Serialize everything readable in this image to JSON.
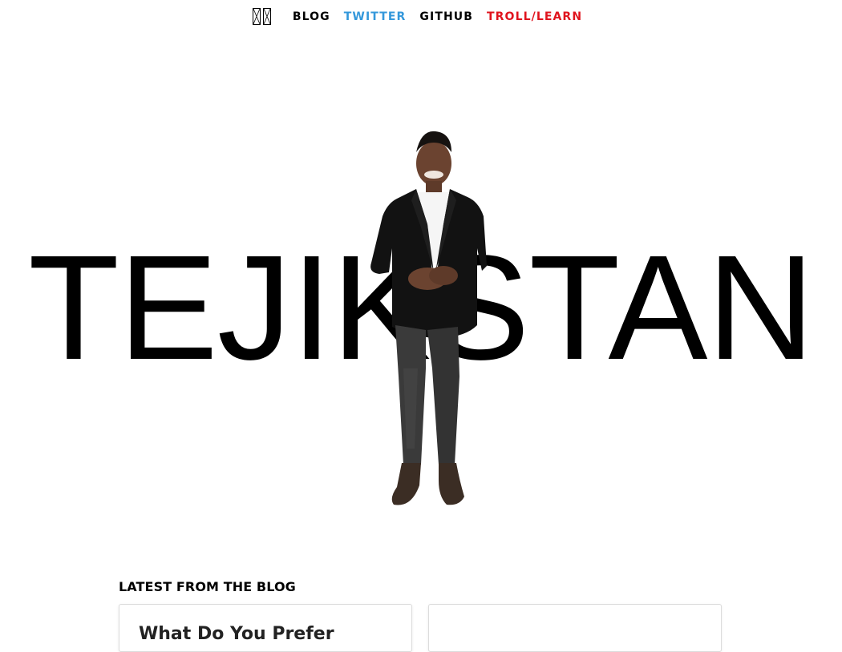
{
  "nav": {
    "logo": "logo-icon",
    "links": [
      {
        "label": "BLOG",
        "color": "#000000"
      },
      {
        "label": "TWITTER",
        "color": "#3498db"
      },
      {
        "label": "GITHUB",
        "color": "#000000"
      },
      {
        "label": "TROLL/LEARN",
        "color": "#e0141e"
      }
    ]
  },
  "hero": {
    "word": "TEJIKSTAN",
    "image": "person-standing-photo"
  },
  "blog": {
    "heading": "LATEST FROM THE BLOG",
    "cards": [
      {
        "title": "What Do You Prefer"
      },
      {
        "title": ""
      }
    ]
  }
}
